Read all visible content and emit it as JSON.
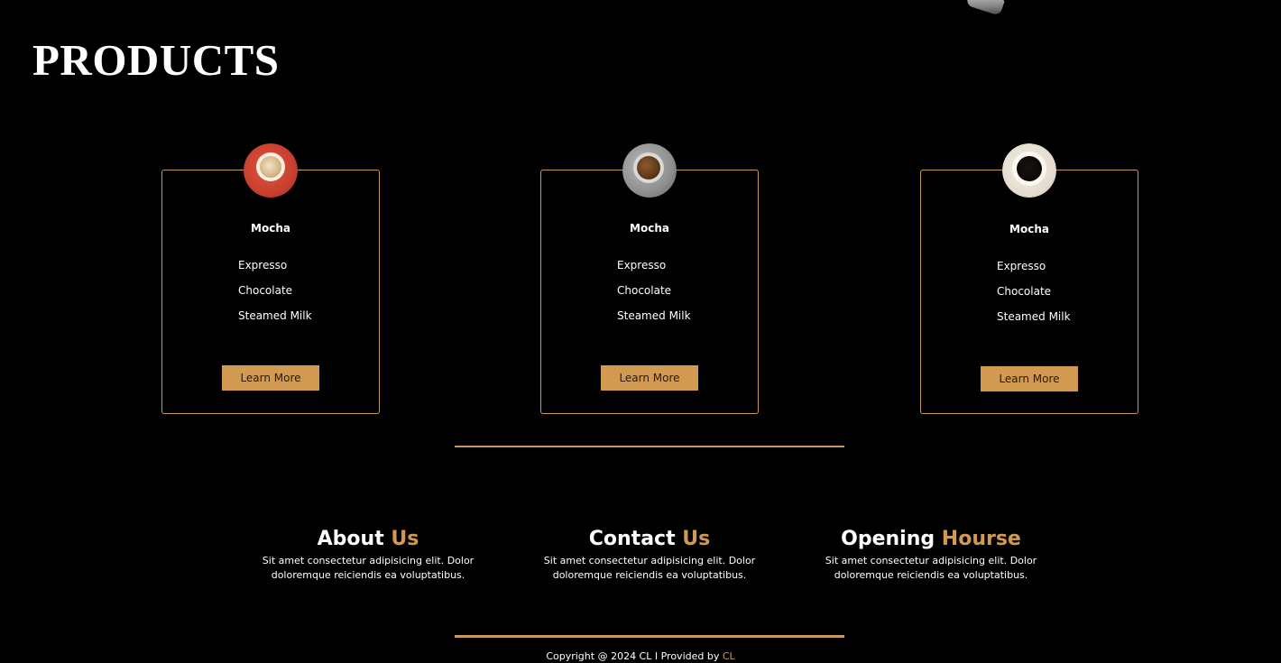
{
  "page": {
    "title": "PRODUCTS"
  },
  "products": [
    {
      "name": "Mocha",
      "ingredients": [
        "Expresso",
        "Chocolate",
        "Steamed Milk"
      ],
      "button_label": "Learn More",
      "image": "latte-cup-on-red-saucer"
    },
    {
      "name": "Mocha",
      "ingredients": [
        "Expresso",
        "Chocolate",
        "Steamed Milk"
      ],
      "button_label": "Learn More",
      "image": "coffee-cup-on-grey-saucer"
    },
    {
      "name": "Mocha",
      "ingredients": [
        "Expresso",
        "Chocolate",
        "Steamed Milk"
      ],
      "button_label": "Learn More",
      "image": "black-coffee-cup-on-white-saucer"
    }
  ],
  "info": [
    {
      "title_main": "About",
      "title_accent": "Us",
      "text": "Sit amet consectetur adipisicing elit. Dolor doloremque reiciendis ea voluptatibus."
    },
    {
      "title_main": "Contact",
      "title_accent": "Us",
      "text": "Sit amet consectetur adipisicing elit. Dolor doloremque reiciendis ea voluptatibus."
    },
    {
      "title_main": "Opening",
      "title_accent": "Hourse",
      "text": "Sit amet consectetur adipisicing elit. Dolor doloremque reiciendis ea voluptatibus."
    }
  ],
  "footer": {
    "text": "Copyright @ 2024 CL I Provided by",
    "accent": "CL"
  },
  "colors": {
    "background": "#000000",
    "accent": "#d19a50",
    "border": "#c89a5c",
    "text": "#ffffff"
  }
}
